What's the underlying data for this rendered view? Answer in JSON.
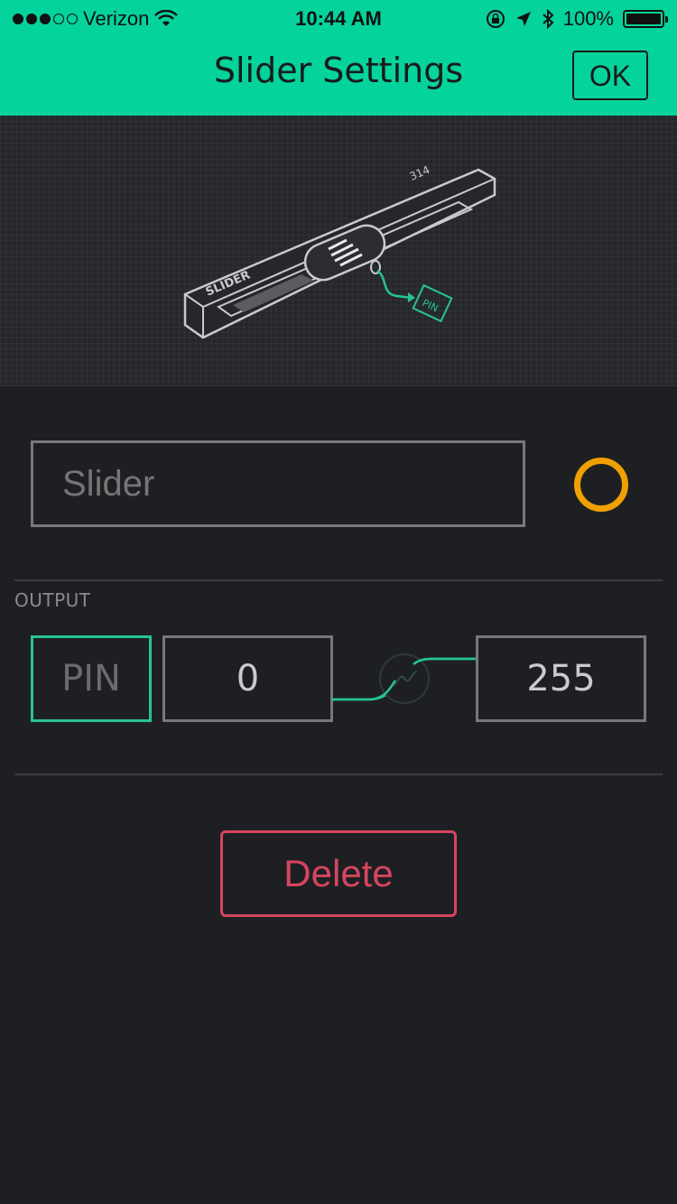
{
  "status_bar": {
    "carrier": "Verizon",
    "time": "10:44 AM",
    "battery": "100%"
  },
  "header": {
    "title": "Slider Settings",
    "ok_label": "OK",
    "background": "#04d39b"
  },
  "illustration": {
    "widget_label": "SLIDER",
    "value_label": "314",
    "pin_label": "PIN"
  },
  "widget": {
    "name_placeholder": "Slider",
    "color": "#f0a000"
  },
  "output": {
    "section_label": "OUTPUT",
    "pin_label": "PIN",
    "min_value": "0",
    "max_value": "255",
    "accent": "#26c492"
  },
  "actions": {
    "delete_label": "Delete",
    "delete_color": "#d5455f"
  }
}
